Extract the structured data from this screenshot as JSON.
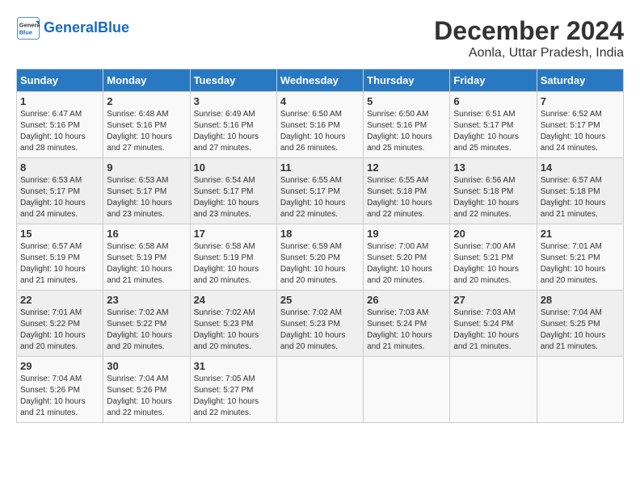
{
  "header": {
    "logo_line1": "General",
    "logo_line2": "Blue",
    "title": "December 2024",
    "subtitle": "Aonla, Uttar Pradesh, India"
  },
  "days_of_week": [
    "Sunday",
    "Monday",
    "Tuesday",
    "Wednesday",
    "Thursday",
    "Friday",
    "Saturday"
  ],
  "weeks": [
    [
      {
        "day": "1",
        "info": "Sunrise: 6:47 AM\nSunset: 5:16 PM\nDaylight: 10 hours\nand 28 minutes."
      },
      {
        "day": "2",
        "info": "Sunrise: 6:48 AM\nSunset: 5:16 PM\nDaylight: 10 hours\nand 27 minutes."
      },
      {
        "day": "3",
        "info": "Sunrise: 6:49 AM\nSunset: 5:16 PM\nDaylight: 10 hours\nand 27 minutes."
      },
      {
        "day": "4",
        "info": "Sunrise: 6:50 AM\nSunset: 5:16 PM\nDaylight: 10 hours\nand 26 minutes."
      },
      {
        "day": "5",
        "info": "Sunrise: 6:50 AM\nSunset: 5:16 PM\nDaylight: 10 hours\nand 25 minutes."
      },
      {
        "day": "6",
        "info": "Sunrise: 6:51 AM\nSunset: 5:17 PM\nDaylight: 10 hours\nand 25 minutes."
      },
      {
        "day": "7",
        "info": "Sunrise: 6:52 AM\nSunset: 5:17 PM\nDaylight: 10 hours\nand 24 minutes."
      }
    ],
    [
      {
        "day": "8",
        "info": "Sunrise: 6:53 AM\nSunset: 5:17 PM\nDaylight: 10 hours\nand 24 minutes."
      },
      {
        "day": "9",
        "info": "Sunrise: 6:53 AM\nSunset: 5:17 PM\nDaylight: 10 hours\nand 23 minutes."
      },
      {
        "day": "10",
        "info": "Sunrise: 6:54 AM\nSunset: 5:17 PM\nDaylight: 10 hours\nand 23 minutes."
      },
      {
        "day": "11",
        "info": "Sunrise: 6:55 AM\nSunset: 5:17 PM\nDaylight: 10 hours\nand 22 minutes."
      },
      {
        "day": "12",
        "info": "Sunrise: 6:55 AM\nSunset: 5:18 PM\nDaylight: 10 hours\nand 22 minutes."
      },
      {
        "day": "13",
        "info": "Sunrise: 6:56 AM\nSunset: 5:18 PM\nDaylight: 10 hours\nand 22 minutes."
      },
      {
        "day": "14",
        "info": "Sunrise: 6:57 AM\nSunset: 5:18 PM\nDaylight: 10 hours\nand 21 minutes."
      }
    ],
    [
      {
        "day": "15",
        "info": "Sunrise: 6:57 AM\nSunset: 5:19 PM\nDaylight: 10 hours\nand 21 minutes."
      },
      {
        "day": "16",
        "info": "Sunrise: 6:58 AM\nSunset: 5:19 PM\nDaylight: 10 hours\nand 21 minutes."
      },
      {
        "day": "17",
        "info": "Sunrise: 6:58 AM\nSunset: 5:19 PM\nDaylight: 10 hours\nand 20 minutes."
      },
      {
        "day": "18",
        "info": "Sunrise: 6:59 AM\nSunset: 5:20 PM\nDaylight: 10 hours\nand 20 minutes."
      },
      {
        "day": "19",
        "info": "Sunrise: 7:00 AM\nSunset: 5:20 PM\nDaylight: 10 hours\nand 20 minutes."
      },
      {
        "day": "20",
        "info": "Sunrise: 7:00 AM\nSunset: 5:21 PM\nDaylight: 10 hours\nand 20 minutes."
      },
      {
        "day": "21",
        "info": "Sunrise: 7:01 AM\nSunset: 5:21 PM\nDaylight: 10 hours\nand 20 minutes."
      }
    ],
    [
      {
        "day": "22",
        "info": "Sunrise: 7:01 AM\nSunset: 5:22 PM\nDaylight: 10 hours\nand 20 minutes."
      },
      {
        "day": "23",
        "info": "Sunrise: 7:02 AM\nSunset: 5:22 PM\nDaylight: 10 hours\nand 20 minutes."
      },
      {
        "day": "24",
        "info": "Sunrise: 7:02 AM\nSunset: 5:23 PM\nDaylight: 10 hours\nand 20 minutes."
      },
      {
        "day": "25",
        "info": "Sunrise: 7:02 AM\nSunset: 5:23 PM\nDaylight: 10 hours\nand 20 minutes."
      },
      {
        "day": "26",
        "info": "Sunrise: 7:03 AM\nSunset: 5:24 PM\nDaylight: 10 hours\nand 21 minutes."
      },
      {
        "day": "27",
        "info": "Sunrise: 7:03 AM\nSunset: 5:24 PM\nDaylight: 10 hours\nand 21 minutes."
      },
      {
        "day": "28",
        "info": "Sunrise: 7:04 AM\nSunset: 5:25 PM\nDaylight: 10 hours\nand 21 minutes."
      }
    ],
    [
      {
        "day": "29",
        "info": "Sunrise: 7:04 AM\nSunset: 5:26 PM\nDaylight: 10 hours\nand 21 minutes."
      },
      {
        "day": "30",
        "info": "Sunrise: 7:04 AM\nSunset: 5:26 PM\nDaylight: 10 hours\nand 22 minutes."
      },
      {
        "day": "31",
        "info": "Sunrise: 7:05 AM\nSunset: 5:27 PM\nDaylight: 10 hours\nand 22 minutes."
      },
      {
        "day": "",
        "info": ""
      },
      {
        "day": "",
        "info": ""
      },
      {
        "day": "",
        "info": ""
      },
      {
        "day": "",
        "info": ""
      }
    ]
  ]
}
